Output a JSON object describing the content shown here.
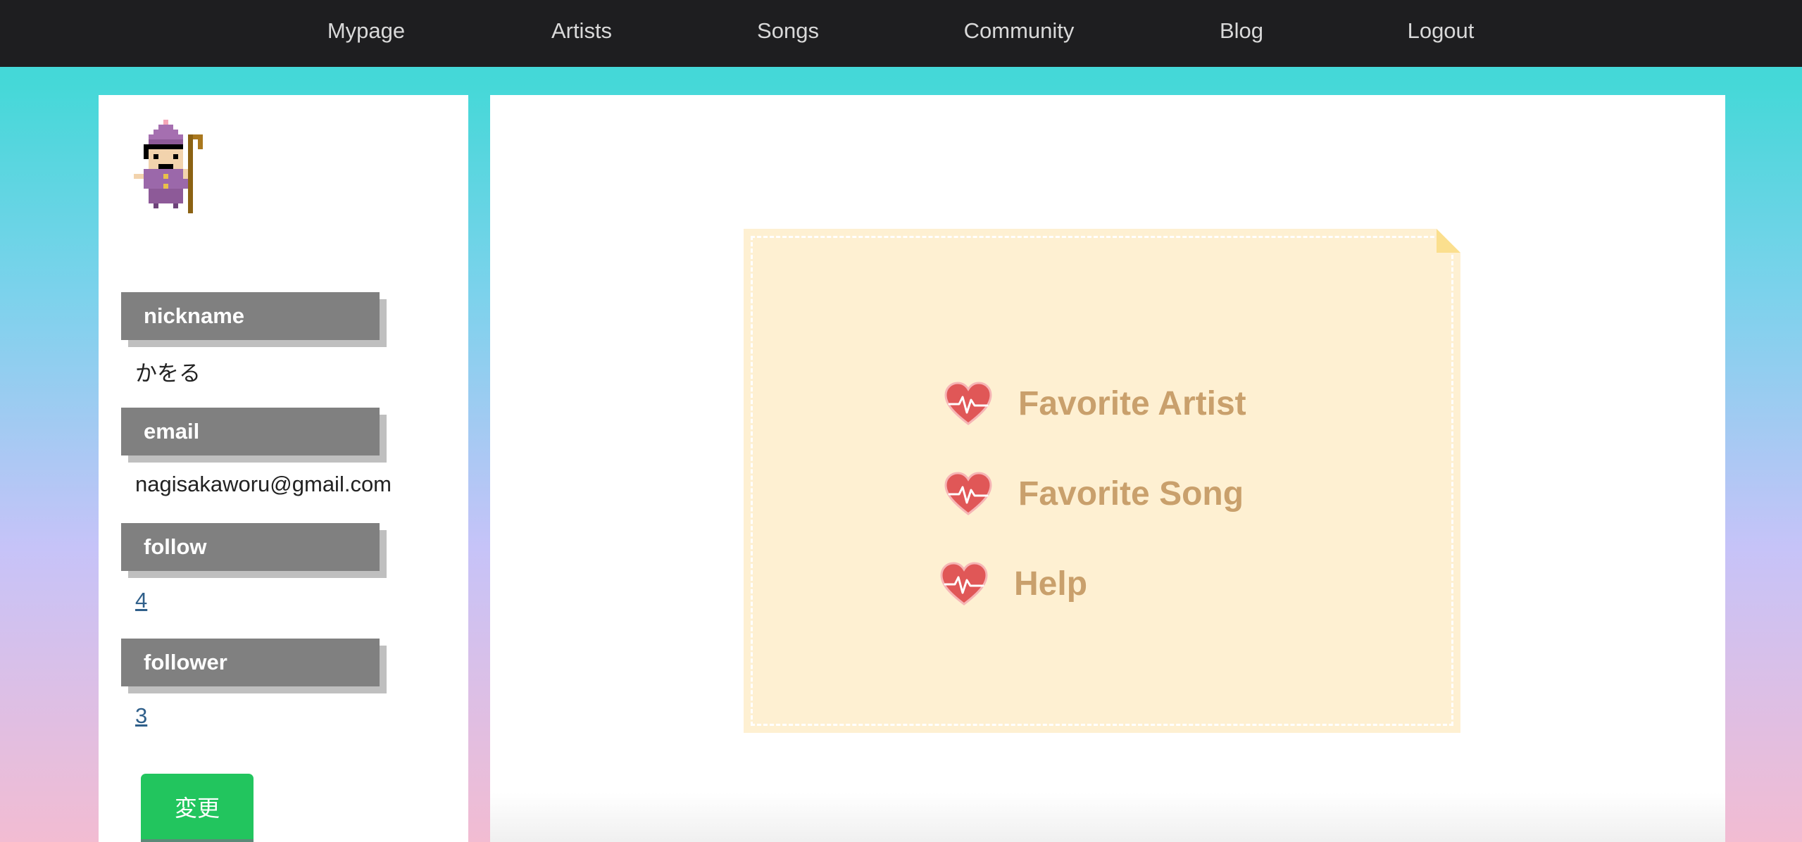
{
  "nav": {
    "items": [
      {
        "label": "Mypage"
      },
      {
        "label": "Artists"
      },
      {
        "label": "Songs"
      },
      {
        "label": "Community"
      },
      {
        "label": "Blog"
      },
      {
        "label": "Logout"
      }
    ]
  },
  "profile": {
    "avatar_icon": "pixel-wizard-icon",
    "fields": [
      {
        "label": "nickname",
        "value": "かをる"
      },
      {
        "label": "email",
        "value": "nagisakaworu@gmail.com"
      },
      {
        "label": "follow",
        "value": "4"
      },
      {
        "label": "follower",
        "value": "3"
      }
    ],
    "change_button": "変更"
  },
  "menu": {
    "items": [
      {
        "label": "Favorite Artist",
        "icon": "heart-pulse-icon"
      },
      {
        "label": "Favorite Song",
        "icon": "heart-pulse-icon"
      },
      {
        "label": "Help",
        "icon": "heart-pulse-icon"
      }
    ]
  },
  "colors": {
    "navbar": "#1e1e20",
    "label_box": "#808080",
    "button": "#22c55e",
    "note": "#fef0d2",
    "menu_text": "#c9a06c",
    "heart": "#e05757"
  }
}
